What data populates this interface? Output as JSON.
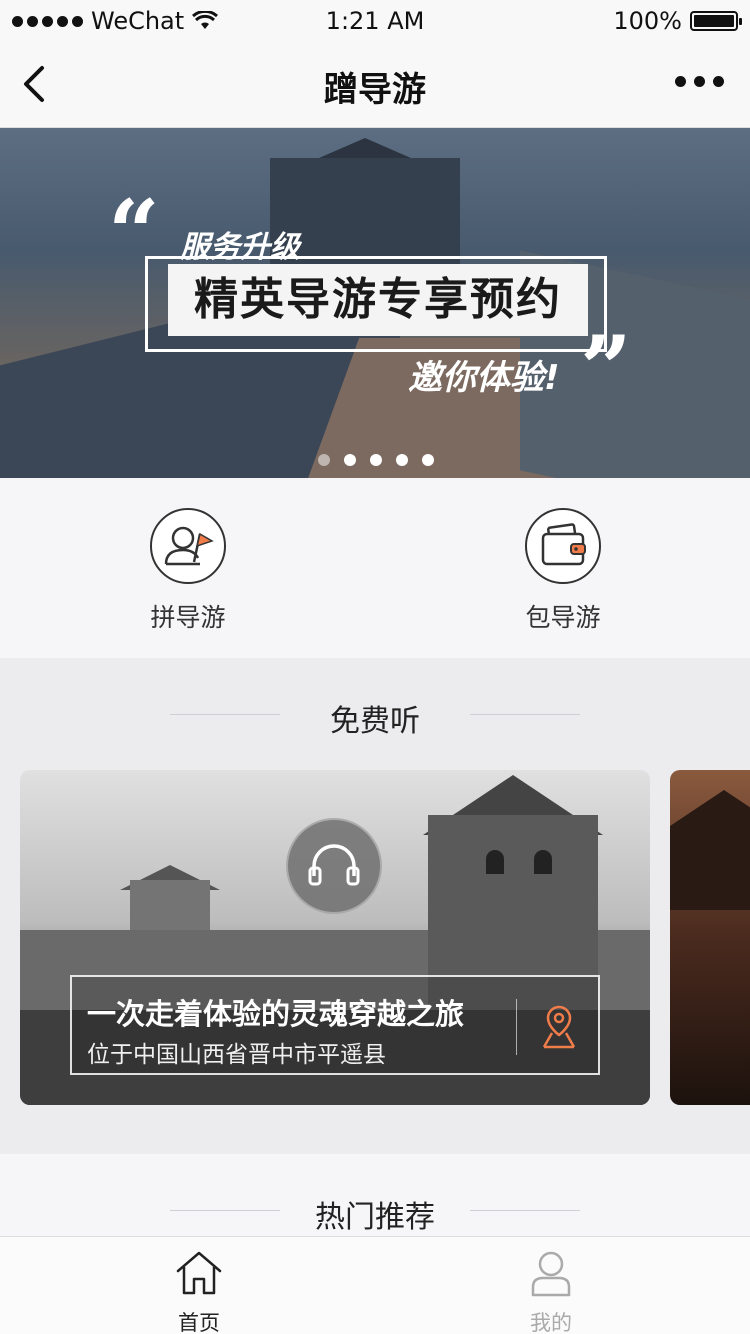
{
  "status_bar": {
    "carrier": "WeChat",
    "time": "1:21 AM",
    "battery": "100%"
  },
  "nav": {
    "title": "蹭导游"
  },
  "banner": {
    "line1": "服务升级",
    "main": "精英导游专享预约",
    "line2": "邀你体验!",
    "active_index": 4,
    "slide_count": 5
  },
  "entries": [
    {
      "label": "拼导游",
      "icon": "guide-flag-icon"
    },
    {
      "label": "包导游",
      "icon": "wallet-icon"
    }
  ],
  "free_listen": {
    "title": "免费听",
    "card": {
      "title": "一次走着体验的灵魂穿越之旅",
      "subtitle": "位于中国山西省晋中市平遥县"
    }
  },
  "hot": {
    "title": "热门推荐"
  },
  "tabbar": [
    {
      "label": "首页",
      "icon": "home-icon",
      "active": true
    },
    {
      "label": "我的",
      "icon": "user-icon",
      "active": false
    }
  ],
  "colors": {
    "accent": "#f07c4a",
    "tab_active": "#222222",
    "tab_inactive": "#aaaaaa"
  }
}
